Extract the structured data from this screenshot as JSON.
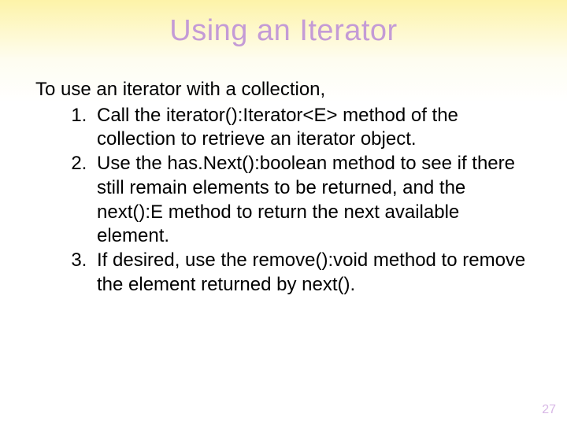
{
  "title": "Using an Iterator",
  "intro": "To use an iterator with a collection,",
  "steps": {
    "s1a": "Call the ",
    "s1code": "iterator():Iterator<E>",
    "s1b": " method of the collection to retrieve an iterator object.",
    "s2a": "Use the ",
    "s2code1": "has.Next():boolean",
    "s2b": " method to see if there still remain elements to be returned, and the ",
    "s2code2": "next():E",
    "s2c": " method to return the next available element.",
    "s3a": "If desired, use the ",
    "s3code1": "remove():void",
    "s3b": " method to remove the element returned by ",
    "s3code2": "next()",
    "s3c": "."
  },
  "page_number": "27"
}
